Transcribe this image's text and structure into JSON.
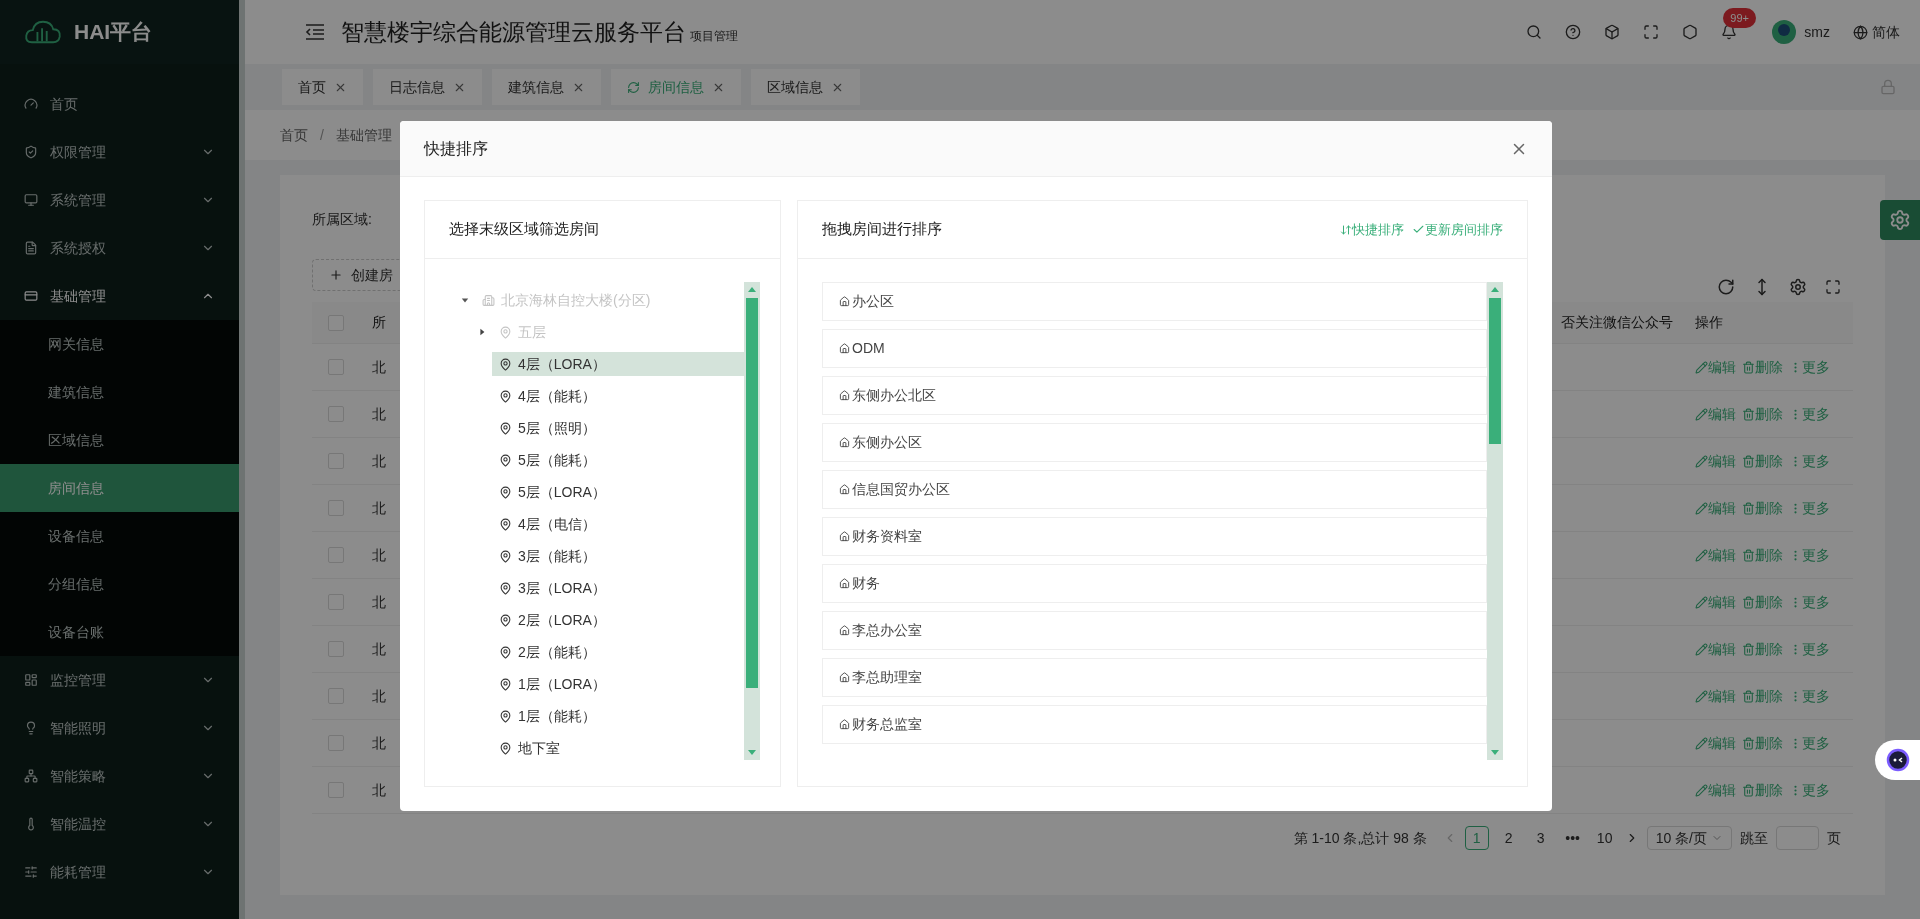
{
  "sidebar": {
    "logo": "HAI平台",
    "items": [
      {
        "kind": "link",
        "label": "首页"
      },
      {
        "kind": "group",
        "label": "权限管理",
        "expanded": false
      },
      {
        "kind": "group",
        "label": "系统管理",
        "expanded": false
      },
      {
        "kind": "group",
        "label": "系统授权",
        "expanded": false
      },
      {
        "kind": "group",
        "label": "基础管理",
        "expanded": true,
        "children": [
          {
            "label": "网关信息",
            "selected": false
          },
          {
            "label": "建筑信息",
            "selected": false
          },
          {
            "label": "区域信息",
            "selected": false
          },
          {
            "label": "房间信息",
            "selected": true
          },
          {
            "label": "设备信息",
            "selected": false
          },
          {
            "label": "分组信息",
            "selected": false
          },
          {
            "label": "设备台账",
            "selected": false
          }
        ]
      },
      {
        "kind": "group",
        "label": "监控管理",
        "expanded": false
      },
      {
        "kind": "group",
        "label": "智能照明",
        "expanded": false
      },
      {
        "kind": "group",
        "label": "智能策略",
        "expanded": false
      },
      {
        "kind": "group",
        "label": "智能温控",
        "expanded": false
      },
      {
        "kind": "group",
        "label": "能耗管理",
        "expanded": false
      }
    ]
  },
  "header": {
    "title": "智慧楼宇综合能源管理云服务平台",
    "subtitle": "项目管理",
    "notification_badge": "99+",
    "user": "smz",
    "language": "简体"
  },
  "tabs": [
    {
      "label": "首页",
      "selected": false
    },
    {
      "label": "日志信息",
      "selected": false
    },
    {
      "label": "建筑信息",
      "selected": false
    },
    {
      "label": "房间信息",
      "selected": true
    },
    {
      "label": "区域信息",
      "selected": false
    }
  ],
  "breadcrumb": {
    "items": [
      "首页",
      "基础管理"
    ],
    "separator": "/"
  },
  "filter": {
    "label": "所属区域:"
  },
  "create_button": "创建房",
  "table": {
    "select_all": {
      "checked": false
    },
    "columns": [
      "所",
      "否关注微信公众号",
      "操作"
    ],
    "rows": [
      {
        "checked": false,
        "column_1": "北",
        "actions": [
          "编辑",
          "删除",
          "更多"
        ]
      },
      {
        "checked": false,
        "column_1": "北",
        "actions": [
          "编辑",
          "删除",
          "更多"
        ]
      },
      {
        "checked": false,
        "column_1": "北",
        "actions": [
          "编辑",
          "删除",
          "更多"
        ]
      },
      {
        "checked": false,
        "column_1": "北",
        "actions": [
          "编辑",
          "删除",
          "更多"
        ]
      },
      {
        "checked": false,
        "column_1": "北",
        "actions": [
          "编辑",
          "删除",
          "更多"
        ]
      },
      {
        "checked": false,
        "column_1": "北",
        "actions": [
          "编辑",
          "删除",
          "更多"
        ]
      },
      {
        "checked": false,
        "column_1": "北",
        "actions": [
          "编辑",
          "删除",
          "更多"
        ]
      },
      {
        "checked": false,
        "column_1": "北",
        "actions": [
          "编辑",
          "删除",
          "更多"
        ]
      },
      {
        "checked": false,
        "column_1": "北",
        "actions": [
          "编辑",
          "删除",
          "更多"
        ]
      },
      {
        "checked": false,
        "column_1": "北",
        "actions": [
          "编辑",
          "删除",
          "更多"
        ]
      }
    ]
  },
  "pagination": {
    "summary": "第 1-10 条,总计 98 条",
    "pages": [
      {
        "label": "1",
        "selected": true
      },
      {
        "label": "2",
        "selected": false
      },
      {
        "label": "3",
        "selected": false
      },
      {
        "label": "•••",
        "selected": false
      },
      {
        "label": "10",
        "selected": false
      }
    ],
    "page_size": "10 条/页",
    "jump_label": "跳至",
    "jump_suffix": "页"
  },
  "dialog": {
    "title": "快捷排序",
    "left_panel": {
      "title": "选择末级区域筛选房间",
      "tree": [
        {
          "kind": "building",
          "label": "北京海林自控大楼(分区)",
          "disabled": true,
          "expanded": true,
          "selected": false,
          "children": [
            {
              "kind": "floor",
              "label": "五层",
              "disabled": true,
              "expanded": false,
              "selected": false
            },
            {
              "kind": "floor",
              "label": "4层（LORA）",
              "disabled": false,
              "selected": true
            },
            {
              "kind": "floor",
              "label": "4层（能耗）",
              "disabled": false,
              "selected": false
            },
            {
              "kind": "floor",
              "label": "5层（照明）",
              "disabled": false,
              "selected": false
            },
            {
              "kind": "floor",
              "label": "5层（能耗）",
              "disabled": false,
              "selected": false
            },
            {
              "kind": "floor",
              "label": "5层（LORA）",
              "disabled": false,
              "selected": false
            },
            {
              "kind": "floor",
              "label": "4层（电信）",
              "disabled": false,
              "selected": false
            },
            {
              "kind": "floor",
              "label": "3层（能耗）",
              "disabled": false,
              "selected": false
            },
            {
              "kind": "floor",
              "label": "3层（LORA）",
              "disabled": false,
              "selected": false
            },
            {
              "kind": "floor",
              "label": "2层（LORA）",
              "disabled": false,
              "selected": false
            },
            {
              "kind": "floor",
              "label": "2层（能耗）",
              "disabled": false,
              "selected": false
            },
            {
              "kind": "floor",
              "label": "1层（LORA）",
              "disabled": false,
              "selected": false
            },
            {
              "kind": "floor",
              "label": "1层（能耗）",
              "disabled": false,
              "selected": false
            },
            {
              "kind": "floor",
              "label": "地下室",
              "disabled": false,
              "selected": false
            }
          ]
        }
      ]
    },
    "right_panel": {
      "title": "拖拽房间进行排序",
      "actions": [
        {
          "kind": "sort",
          "label": "快捷排序"
        },
        {
          "kind": "confirm",
          "label": "更新房间排序"
        }
      ],
      "rooms": [
        "办公区",
        "ODM",
        "东侧办公北区",
        "东侧办公区",
        "信息国贸办公区",
        "财务资料室",
        "财务",
        "李总办公室",
        "李总助理室",
        "财务总监室"
      ]
    }
  }
}
